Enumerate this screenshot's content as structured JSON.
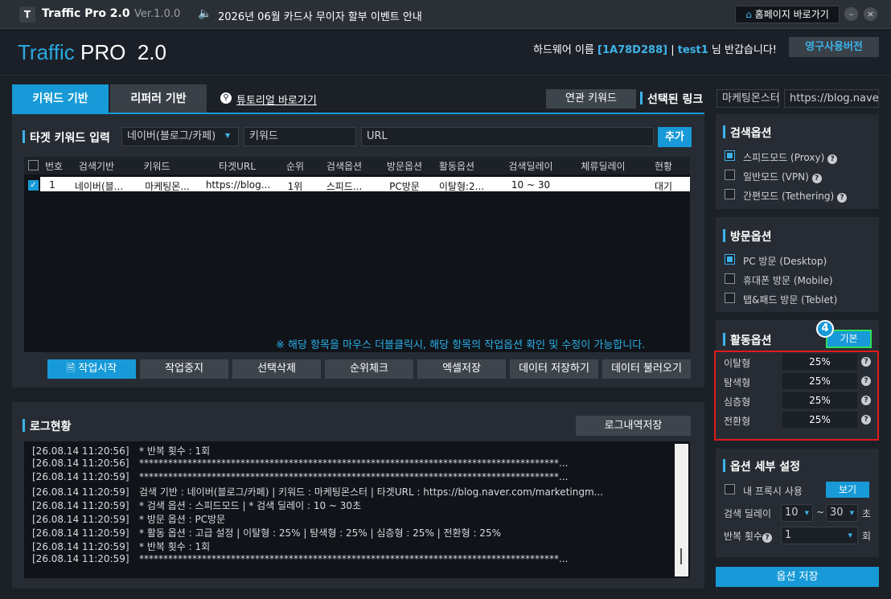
{
  "titlebar": {
    "logo": "T",
    "app_name": "Traffic Pro 2.0",
    "version": "Ver.1.0.0",
    "notice": "2026년 06월 카드사 무이자 할부 이벤트 안내",
    "home_button": "홈페이지 바로가기",
    "minimize": "–",
    "close": "×"
  },
  "header": {
    "brand_a": "Traffic",
    "brand_b": " PRO",
    "brand_c": "2.0",
    "hw_label": "하드웨어 이름",
    "hw_id": "[1A78D288]",
    "sep": "|",
    "user": "test1",
    "greet": "님 반갑습니다!",
    "license_button": "영구사용버전"
  },
  "tabs": {
    "keyword": "키워드 기반",
    "referrer": "리퍼러 기반",
    "tutorial": "튜토리얼 바로가기"
  },
  "related": {
    "button": "연관 키워드",
    "selected_link": "선택된 링크",
    "input1": "마케팅몬스터",
    "input2": "https://blog.naver.c"
  },
  "target": {
    "title": "타겟 키워드 입력",
    "platform": "네이버(블로그/카페)",
    "keyword_placeholder": "키워드",
    "url_placeholder": "URL",
    "add": "추가"
  },
  "table": {
    "headers": [
      "번호",
      "검색기반",
      "키워드",
      "타겟URL",
      "순위",
      "검색옵션",
      "방문옵션",
      "활동옵션",
      "검색딜레이",
      "체류딜레이",
      "현황"
    ],
    "rows": [
      [
        "1",
        "네이버(블...",
        "마케팅몬...",
        "https://blog...",
        "1위",
        "스피드...",
        "PC방문",
        "이탈형:2...",
        "10 ~ 30",
        "",
        "대기"
      ]
    ]
  },
  "hint": "※ 해당 항목을 마우스 더블클릭시, 해당 항목의 작업옵션 확인 및 수정이 가능합니다.",
  "toolbar": {
    "start": "작업시작",
    "stop": "작업중지",
    "delete": "선택삭제",
    "rank": "순위체크",
    "excel": "엑셀저장",
    "save_data": "데이터 저장하기",
    "load_data": "데이터 불러오기"
  },
  "log": {
    "title": "로그현황",
    "save": "로그내역저장",
    "lines": [
      [
        "[26.08.14 11:20:56]",
        "* 반복 횟수 : 1회"
      ],
      [
        "[26.08.14 11:20:56]",
        "***************************************************************************************..."
      ],
      [
        "[26.08.14 11:20:59]",
        "***************************************************************************************..."
      ],
      [
        "[26.08.14 11:20:59]",
        "검색 기반 : 네이버(블로그/카페) | 키워드 : 마케팅몬스터 | 타겟URL : https://blog.naver.com/marketingm..."
      ],
      [
        "[26.08.14 11:20:59]",
        "* 검색 옵션 : 스피드모드 | * 검색 딜레이 : 10 ~ 30초"
      ],
      [
        "[26.08.14 11:20:59]",
        "* 방문 옵션 : PC방문"
      ],
      [
        "[26.08.14 11:20:59]",
        "* 활동 옵션 : 고급 설정 | 이탈형 : 25% | 탐색형 : 25% | 심층형 : 25% | 전환형 : 25%"
      ],
      [
        "[26.08.14 11:20:59]",
        "* 반복 횟수 : 1회"
      ],
      [
        "[26.08.14 11:20:59]",
        "***************************************************************************************..."
      ]
    ]
  },
  "search_options": {
    "title": "검색옵션",
    "items": [
      "스피드모드 (Proxy)",
      "일반모드 (VPN)",
      "간편모드 (Tethering)"
    ]
  },
  "visit_options": {
    "title": "방문옵션",
    "items": [
      "PC 방문 (Desktop)",
      "휴대폰 방문 (Mobile)",
      "탭&패드 방문 (Teblet)"
    ]
  },
  "activity_options": {
    "title": "활동옵션",
    "badge": "4",
    "default_button": "기본",
    "items": [
      {
        "label": "이탈형",
        "value": "25%"
      },
      {
        "label": "탐색형",
        "value": "25%"
      },
      {
        "label": "심층형",
        "value": "25%"
      },
      {
        "label": "전환형",
        "value": "25%"
      }
    ]
  },
  "detail": {
    "title": "옵션 세부 설정",
    "proxy_label": "내 프록시 사용",
    "view": "보기",
    "delay_label": "검색 딜레이",
    "delay_from": "10",
    "tilde": "~",
    "delay_to": "30",
    "sec": "초",
    "repeat_label": "반복 횟수",
    "repeat_value": "1",
    "times": "회"
  },
  "save_options": "옵션 저장",
  "q": "?",
  "colors": {
    "accent": "#179ad7",
    "highlight": "#3db3ea",
    "alert": "#e01b1b"
  }
}
